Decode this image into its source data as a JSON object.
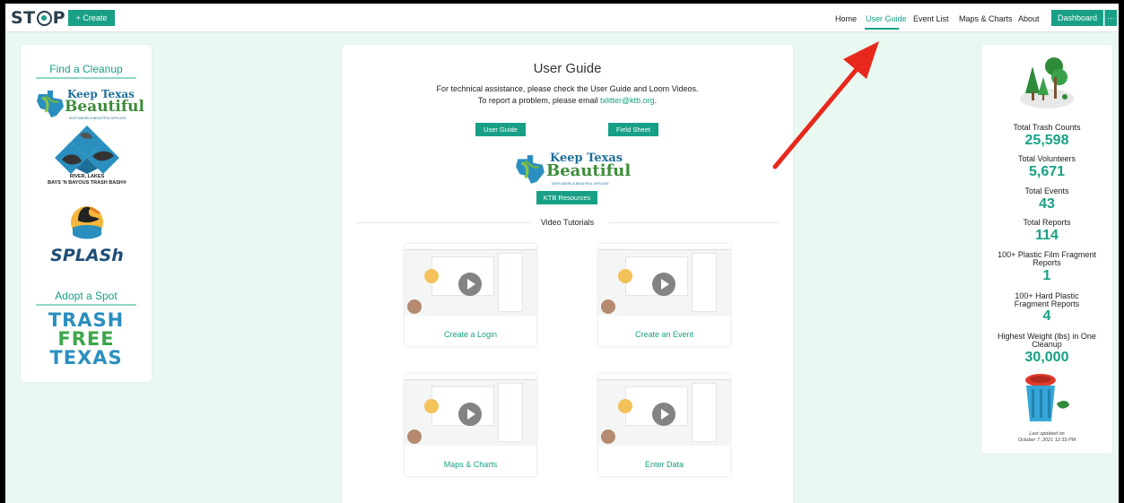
{
  "header": {
    "logo": {
      "pre": "ST",
      "post": "P"
    },
    "create_label": "+ Create",
    "nav": [
      {
        "label": "Home",
        "active": false
      },
      {
        "label": "User Guide",
        "active": true
      },
      {
        "label": "Event List",
        "active": false
      },
      {
        "label": "Maps & Charts",
        "active": false
      },
      {
        "label": "About",
        "active": false
      }
    ],
    "dashboard_label": "Dashboard",
    "more_label": "···"
  },
  "left_sidebar": {
    "find_heading": "Find a Cleanup",
    "adopt_heading": "Adopt a Spot",
    "ktb_logo": {
      "line1": "Keep Texas",
      "line2": "Beautiful",
      "tagline": "KEEP AMERICA BEAUTIFUL AFFILIATE"
    },
    "river_logo": {
      "line1": "RIVER, LAKES",
      "line2": "BAYS 'N BAYOUS TRASH BASH®"
    },
    "splash_logo": "SPLASh",
    "trash_free": [
      "TRASH",
      "FREE",
      "TEXAS"
    ]
  },
  "center": {
    "title": "User Guide",
    "line1": "For technical assistance, please check the User Guide and Loom Videos.",
    "line2_prefix": "To report a problem, please email ",
    "email": "txlitter@ktb.org",
    "line2_suffix": ".",
    "user_guide_btn": "User Guide",
    "field_sheet_btn": "Field Sheet",
    "ktb_logo": {
      "line1": "Keep Texas",
      "line2": "Beautiful",
      "tagline": "KEEP AMERICA BEAUTIFUL AFFILIATE"
    },
    "ktb_resources_btn": "KTB Resources",
    "video_heading": "Video Tutorials",
    "videos": [
      {
        "caption": "Create a Login"
      },
      {
        "caption": "Create an Event"
      },
      {
        "caption": "Maps & Charts"
      },
      {
        "caption": "Enter Data"
      }
    ]
  },
  "stats": {
    "items": [
      {
        "label": "Total Trash Counts",
        "value": "25,598"
      },
      {
        "label": "Total Volunteers",
        "value": "5,671"
      },
      {
        "label": "Total Events",
        "value": "43"
      },
      {
        "label": "Total Reports",
        "value": "114"
      },
      {
        "label": "100+ Plastic Film Fragment Reports",
        "value": "1"
      },
      {
        "label": "100+ Hard Plastic Fragment Reports",
        "value": "4"
      },
      {
        "label": "Highest Weight (lbs) in One Cleanup",
        "value": "30,000"
      }
    ],
    "updated_line1": "Last updated on",
    "updated_line2": "October 7, 2021 12:33 PM"
  },
  "colors": {
    "accent": "#18a086",
    "background": "#e9f8f1",
    "arrow": "#e8281c"
  }
}
